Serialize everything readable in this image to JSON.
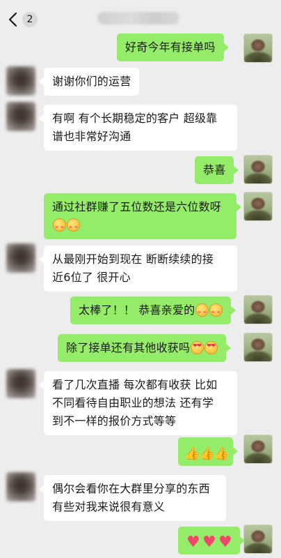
{
  "header": {
    "back_icon": "chevron-left-icon",
    "unread_count": "2"
  },
  "messages": [
    {
      "side": "right",
      "text": "好奇今年有接单吗"
    },
    {
      "side": "left",
      "text": "谢谢你们的运营"
    },
    {
      "side": "left",
      "line1": "有啊 有个长期稳定的客户 超级靠",
      "line2": "谱也非常好沟通"
    },
    {
      "side": "right",
      "text": "恭喜"
    },
    {
      "side": "right",
      "line1": "通过社群赚了五位数还是六位数呀",
      "emojis": [
        "blush",
        "blush"
      ]
    },
    {
      "side": "left",
      "line1": "从最刚开始到现在 断断续续的接",
      "line2": "近6位了 很开心"
    },
    {
      "side": "right",
      "text": "太棒了！！ 恭喜亲爱的",
      "emojis": [
        "blush",
        "blush"
      ]
    },
    {
      "side": "right",
      "text": "除了接单还有其他收获吗",
      "emojis": [
        "heart-eyes",
        "heart-eyes"
      ]
    },
    {
      "side": "left",
      "line1": "看了几次直播 每次都有收获 比如",
      "line2": "不同看待自由职业的想法 还有学",
      "line3": "到不一样的报价方式等等"
    },
    {
      "side": "right",
      "emojis": [
        "thumbs-up",
        "thumbs-up",
        "thumbs-up"
      ]
    },
    {
      "side": "left",
      "line1": "偶尔会看你在大群里分享的东西",
      "line2": "有些对我来说很有意义"
    },
    {
      "side": "right",
      "emojis": [
        "heart",
        "heart",
        "heart"
      ]
    }
  ],
  "colors": {
    "background": "#ededed",
    "outgoing_bubble": "#95ec69",
    "incoming_bubble": "#ffffff"
  }
}
